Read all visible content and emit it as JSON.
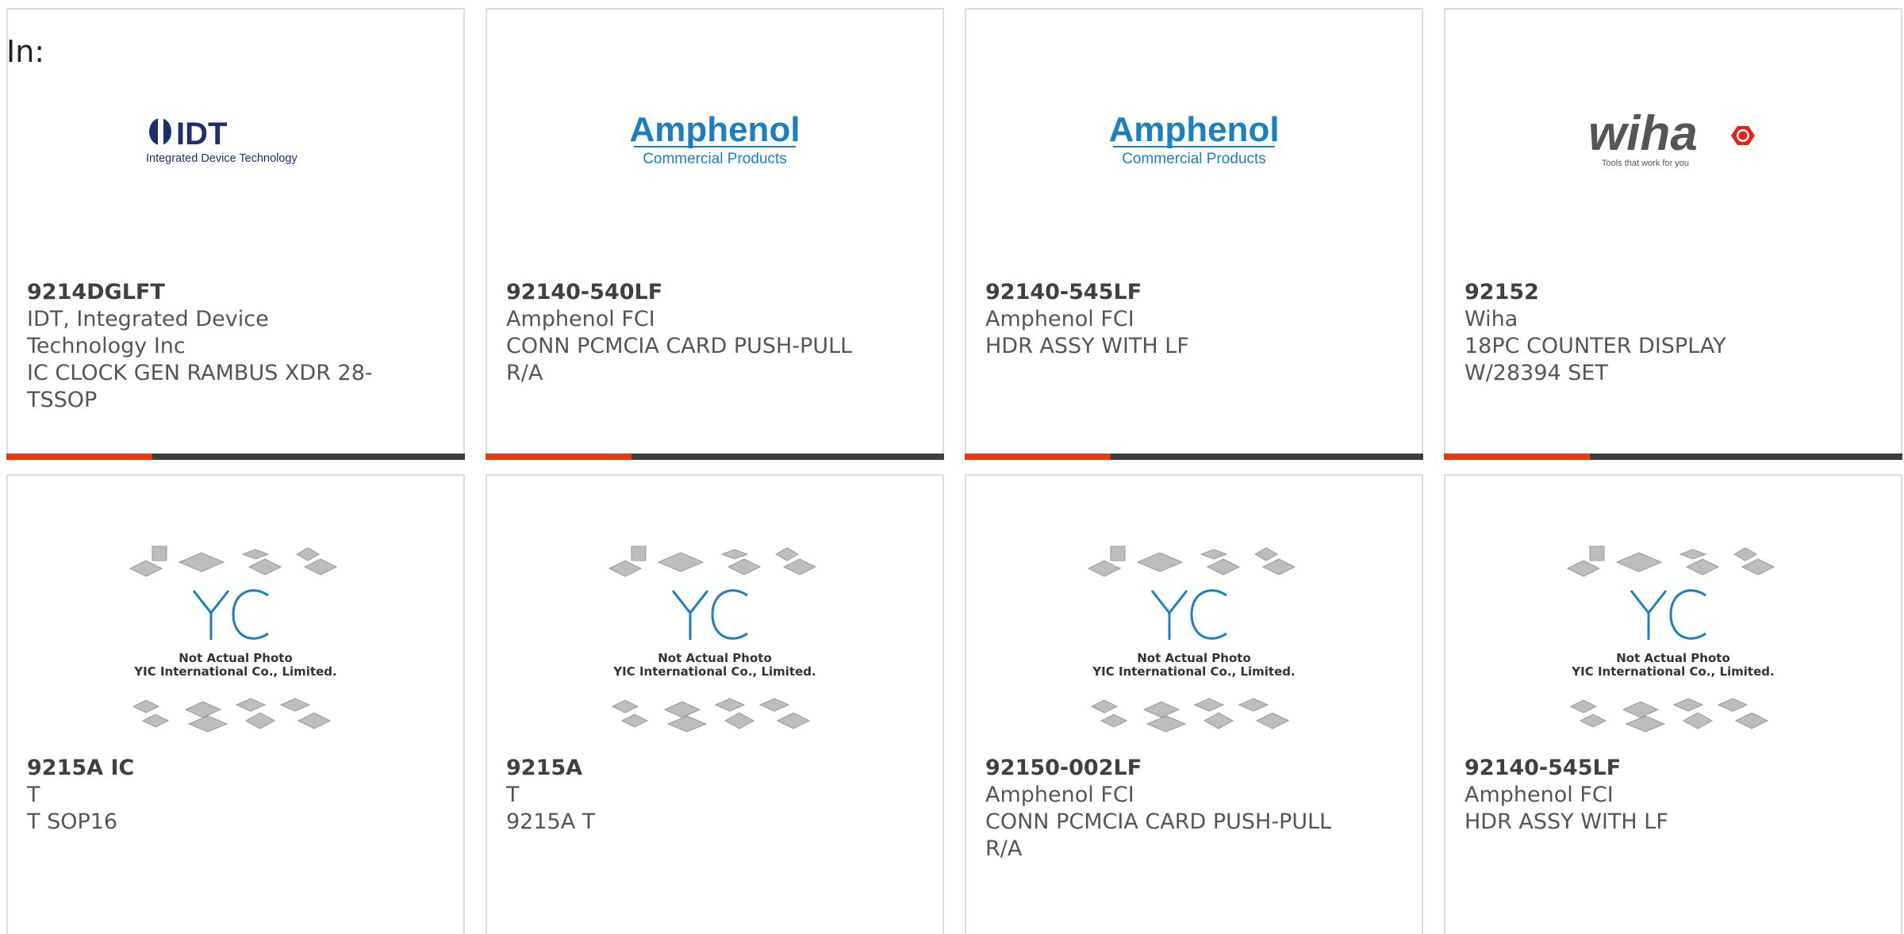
{
  "search": {
    "label": "In:"
  },
  "colors": {
    "accent": "#e8380d",
    "bar": "#3d3d3d",
    "card_border": "#dcdcdc"
  },
  "row1": [
    {
      "part": "9214DGLFT",
      "brand": "IDT, Integrated Device Technology Inc",
      "desc": "IC CLOCK GEN RAMBUS XDR 28-TSSOP",
      "logo": "idt-logo",
      "logo_text": [
        "IDT",
        "Integrated Device Technology"
      ]
    },
    {
      "part": "92140-540LF",
      "brand": "Amphenol FCI",
      "desc": "CONN PCMCIA CARD PUSH-PULL R/A",
      "logo": "amphenol-logo",
      "logo_text": [
        "Amphenol",
        "Commercial Products"
      ]
    },
    {
      "part": "92140-545LF",
      "brand": "Amphenol FCI",
      "desc": "HDR ASSY WITH LF",
      "logo": "amphenol-logo",
      "logo_text": [
        "Amphenol",
        "Commercial Products"
      ]
    },
    {
      "part": "92152",
      "brand": "Wiha",
      "desc": "18PC COUNTER DISPLAY W/28394 SET",
      "logo": "wiha-logo",
      "logo_text": [
        "wiha",
        "Tools that work for you"
      ]
    }
  ],
  "row2": [
    {
      "part": "9215A IC",
      "brand": "T",
      "desc": "T SOP16",
      "logo": "yic-placeholder",
      "logo_text": [
        "Not Actual Photo",
        "YIC International Co., Limited."
      ]
    },
    {
      "part": "9215A",
      "brand": "T",
      "desc": "9215A T",
      "logo": "yic-placeholder",
      "logo_text": [
        "Not Actual Photo",
        "YIC International Co., Limited."
      ]
    },
    {
      "part": "92150-002LF",
      "brand": "Amphenol FCI",
      "desc": "CONN PCMCIA CARD PUSH-PULL R/A",
      "logo": "yic-placeholder",
      "logo_text": [
        "Not Actual Photo",
        "YIC International Co., Limited."
      ]
    },
    {
      "part": "92140-545LF",
      "brand": "Amphenol FCI",
      "desc": "HDR ASSY WITH LF",
      "logo": "yic-placeholder",
      "logo_text": [
        "Not Actual Photo",
        "YIC International Co., Limited."
      ]
    }
  ]
}
